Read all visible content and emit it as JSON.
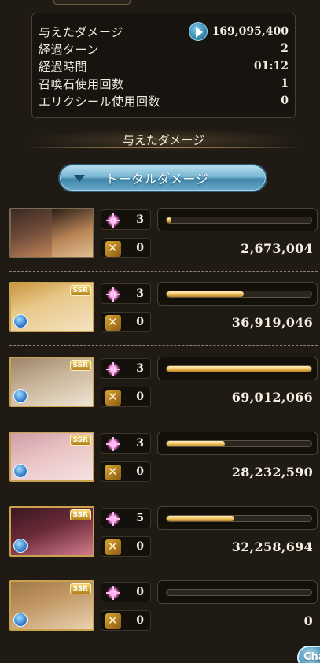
{
  "stats": {
    "rows": [
      {
        "label": "与えたダメージ",
        "value": "169,095,400"
      },
      {
        "label": "経過ターン",
        "value": "2"
      },
      {
        "label": "経過時間",
        "value": "01:12"
      },
      {
        "label": "召喚石使用回数",
        "value": "1"
      },
      {
        "label": "エリクシール使用回数",
        "value": "0"
      }
    ]
  },
  "section": {
    "heading": "与えたダメージ",
    "toggle_label": "トータルダメージ"
  },
  "characters": [
    {
      "ca": "3",
      "skill": "0",
      "damage": "2,673,004",
      "bar_pct": 3,
      "rarity": "",
      "colors": [
        "#6e4a3a",
        "#c79a64"
      ]
    },
    {
      "ca": "3",
      "skill": "0",
      "damage": "36,919,046",
      "bar_pct": 53,
      "rarity": "SSR",
      "colors": [
        "#e8c889",
        "#f4e2c2"
      ]
    },
    {
      "ca": "3",
      "skill": "0",
      "damage": "69,012,066",
      "bar_pct": 100,
      "rarity": "SSR",
      "colors": [
        "#c8b59a",
        "#efe4d2"
      ]
    },
    {
      "ca": "3",
      "skill": "0",
      "damage": "28,232,590",
      "bar_pct": 40,
      "rarity": "SSR",
      "colors": [
        "#e9c3c4",
        "#f7e3e3"
      ]
    },
    {
      "ca": "5",
      "skill": "0",
      "damage": "32,258,694",
      "bar_pct": 47,
      "rarity": "SSR",
      "colors": [
        "#6a2a38",
        "#d37a8d"
      ]
    },
    {
      "ca": "0",
      "skill": "0",
      "damage": "0",
      "bar_pct": 0,
      "rarity": "SSR",
      "colors": [
        "#c49a68",
        "#ead2b2"
      ]
    }
  ],
  "chat_label": "Cha"
}
